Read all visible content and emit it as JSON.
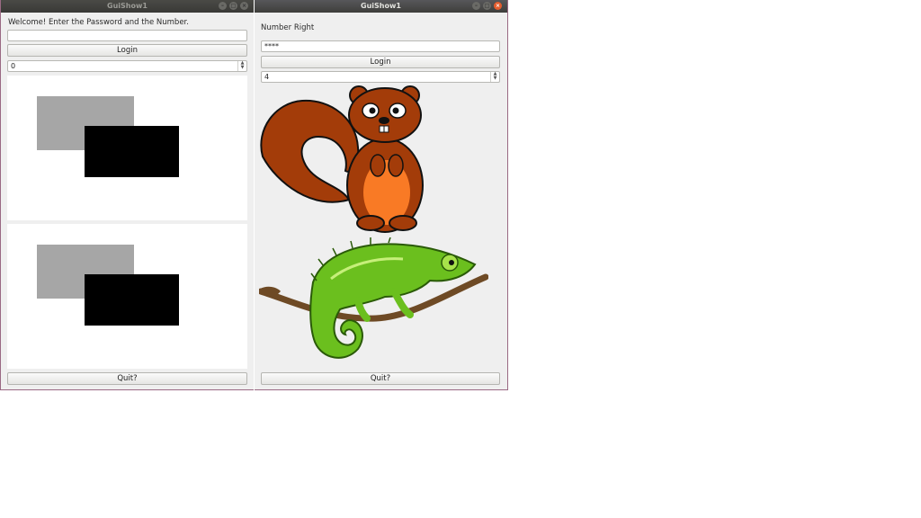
{
  "left_window": {
    "title": "GuiShow1",
    "prompt": "Welcome! Enter the Password and the Number.",
    "password_value": "",
    "login_label": "Login",
    "number_value": "0",
    "quit_label": "Quit?"
  },
  "right_window": {
    "title": "GuiShow1",
    "status": "Number Right",
    "password_value": "****",
    "login_label": "Login",
    "number_value": "4",
    "quit_label": "Quit?"
  },
  "icons": {
    "minimize": "minimize-icon",
    "maximize": "maximize-icon",
    "close": "close-icon",
    "spin_up": "chevron-up-icon",
    "spin_down": "chevron-down-icon"
  },
  "colors": {
    "light_rect": "#a6a6a6",
    "dark_rect": "#000000",
    "close_button": "#e45d2e",
    "squirrel_body": "#a33c09",
    "chameleon_body": "#6bbf1e"
  }
}
